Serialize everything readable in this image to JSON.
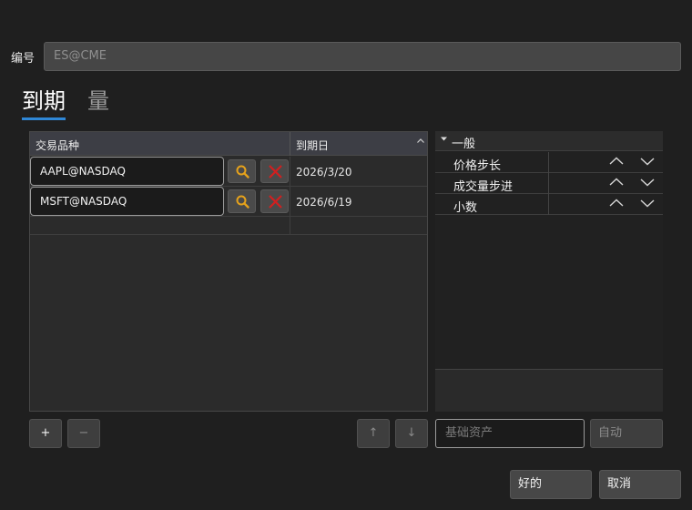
{
  "header": {
    "id_label": "编号",
    "id_placeholder": "ES@CME"
  },
  "tabs": [
    {
      "label": "到期",
      "active": true
    },
    {
      "label": "量",
      "active": false
    }
  ],
  "table": {
    "columns": [
      "交易品种",
      "到期日"
    ],
    "sort_indicator": "^",
    "rows": [
      {
        "symbol": "AAPL@NASDAQ",
        "expiry": "2026/3/20"
      },
      {
        "symbol": "MSFT@NASDAQ",
        "expiry": "2026/6/19"
      }
    ]
  },
  "properties": {
    "group": "一般",
    "items": [
      {
        "label": "价格步长"
      },
      {
        "label": "成交量步进"
      },
      {
        "label": "小数"
      }
    ]
  },
  "toolbar": {
    "add_label": "+",
    "remove_label": "−",
    "up_label": "↑",
    "down_label": "↓",
    "underlying_placeholder": "基础资产",
    "auto_label": "自动"
  },
  "dialog": {
    "ok_label": "好的",
    "cancel_label": "取消"
  },
  "colors": {
    "accent": "#2f87d6",
    "search_icon": "#e6a21b",
    "remove_icon": "#d11f1f"
  },
  "icons": [
    "search-icon",
    "remove-icon",
    "caret-down-icon",
    "chevron-up-icon",
    "chevron-down-icon"
  ]
}
